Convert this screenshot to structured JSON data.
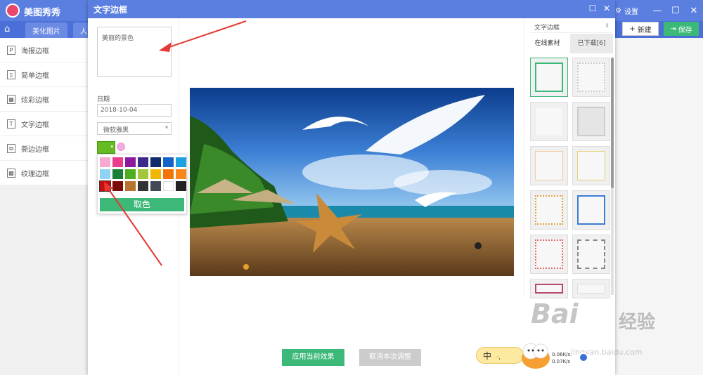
{
  "app": {
    "title": "美图秀秀",
    "settings_label": "设置",
    "minimize": "—",
    "maximize": "☐",
    "close": "✕"
  },
  "tabs": [
    {
      "label": "美化图片"
    },
    {
      "label": "人"
    }
  ],
  "toolbar": {
    "new_label": "新建",
    "save_label": "保存"
  },
  "sidebar": {
    "items": [
      {
        "label": "海报边框",
        "icon": "P"
      },
      {
        "label": "简单边框",
        "icon": "▯"
      },
      {
        "label": "炫彩边框",
        "icon": "▦"
      },
      {
        "label": "文字边框",
        "icon": "T"
      },
      {
        "label": "撕边边框",
        "icon": "⧉"
      },
      {
        "label": "纹理边框",
        "icon": "▩"
      }
    ]
  },
  "dialog": {
    "title": "文字边框",
    "text_value": "美丽的景色",
    "date_label": "日期",
    "date_value": "2018-10-04",
    "font_value": "微软雅黑",
    "selected_color": "#66bb22",
    "palette": [
      "#f9a8d4",
      "#e83e8c",
      "#8b1a9e",
      "#3d2a8a",
      "#10296a",
      "#1563c7",
      "#1ba1e2",
      "#8fd3f4",
      "#188038",
      "#4caf1d",
      "#a4c639",
      "#f2b705",
      "#f27405",
      "#f9861a",
      "#c60c0c",
      "#7a0c0c",
      "#b8732e",
      "#333333",
      "#444a55",
      "#ffffff",
      "#222222"
    ],
    "pick_color_label": "取色",
    "apply_label": "应用当前效果",
    "cancel_label": "取消本次调整"
  },
  "right_panel": {
    "category": "文字边框",
    "tab_online": "在线素材",
    "tab_downloaded": "已下载[6]"
  },
  "taskbar": {
    "ime_label": "中",
    "net_up": "0.06K/s",
    "net_down": "0.07K/s"
  },
  "watermark": {
    "brand": "Bai",
    "brand_cn": "经验",
    "url": "jingyan.baidu.com"
  }
}
